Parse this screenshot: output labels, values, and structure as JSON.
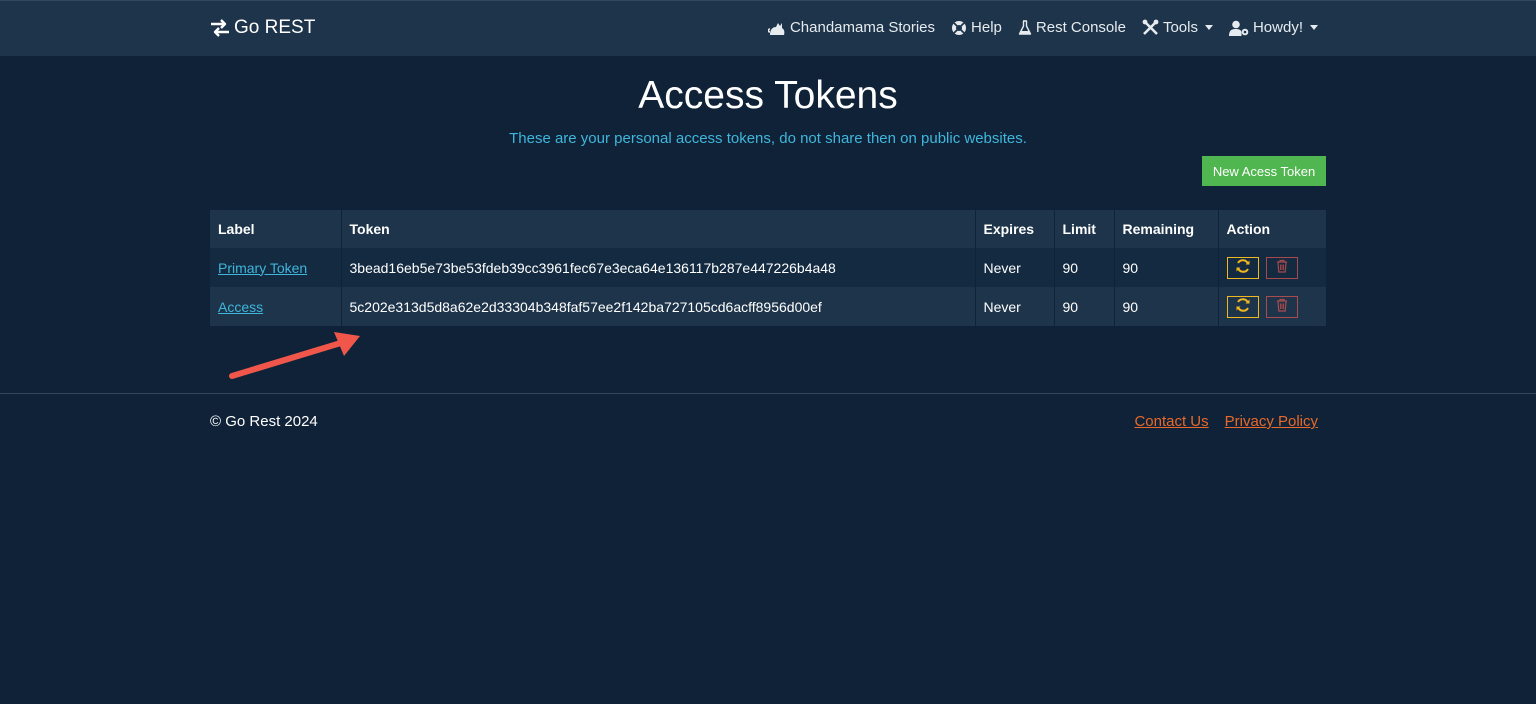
{
  "nav": {
    "brand": "Go REST",
    "items": [
      {
        "label": "Chandamama Stories",
        "icon": "cat-icon"
      },
      {
        "label": "Help",
        "icon": "life-ring-icon"
      },
      {
        "label": "Rest Console",
        "icon": "flask-icon"
      },
      {
        "label": "Tools",
        "icon": "tools-icon",
        "dropdown": true
      },
      {
        "label": "Howdy!",
        "icon": "user-gear-icon",
        "dropdown": true
      }
    ]
  },
  "main": {
    "title": "Access Tokens",
    "subtitle": "These are your personal access tokens, do not share then on public websites.",
    "new_token_label": "New Acess Token"
  },
  "table": {
    "headers": [
      "Label",
      "Token",
      "Expires",
      "Limit",
      "Remaining",
      "Action"
    ],
    "rows": [
      {
        "label": "Primary Token",
        "token": "3bead16eb5e73be53fdeb39cc3961fec67e3eca64e136117b287e447226b4a48",
        "expires": "Never",
        "limit": "90",
        "remaining": "90"
      },
      {
        "label": "Access",
        "token": "5c202e313d5d8a62e2d33304b348faf57ee2f142ba727105cd6acff8956d00ef",
        "expires": "Never",
        "limit": "90",
        "remaining": "90"
      }
    ]
  },
  "footer": {
    "copyright": "© Go Rest 2024",
    "links": [
      "Contact Us",
      "Privacy Policy"
    ]
  },
  "colors": {
    "background": "#0f2237",
    "navbar": "#1e344a",
    "accent_link": "#3fb6dc",
    "success": "#50b650",
    "warning": "#f0b720",
    "danger": "#d9534f",
    "footer_link": "#e8692a",
    "annotation_arrow": "#f0574a"
  }
}
